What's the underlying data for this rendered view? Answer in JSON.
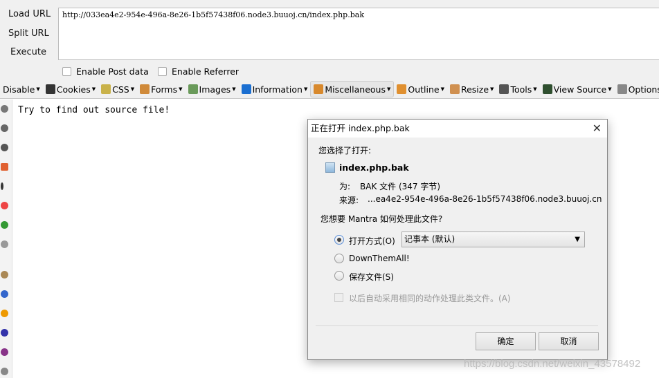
{
  "hackbar": {
    "load_url": "Load URL",
    "split_url": "Split URL",
    "execute": "Execute",
    "url": "http://033ea4e2-954e-496a-8e26-1b5f57438f06.node3.buuoj.cn/index.php.bak",
    "enable_post": "Enable Post data",
    "enable_referrer": "Enable Referrer"
  },
  "toolbar": [
    {
      "label": "Disable",
      "icon": "disable-icon",
      "color": "#d33"
    },
    {
      "label": "Cookies",
      "icon": "cookies-icon",
      "color": "#333"
    },
    {
      "label": "CSS",
      "icon": "css-icon",
      "color": "#c9b24a"
    },
    {
      "label": "Forms",
      "icon": "forms-icon",
      "color": "#d08a3a"
    },
    {
      "label": "Images",
      "icon": "images-icon",
      "color": "#6a9a5a"
    },
    {
      "label": "Information",
      "icon": "information-icon",
      "color": "#1b6fd1"
    },
    {
      "label": "Miscellaneous",
      "icon": "miscellaneous-icon",
      "color": "#d8892d"
    },
    {
      "label": "Outline",
      "icon": "outline-icon",
      "color": "#e09030"
    },
    {
      "label": "Resize",
      "icon": "resize-icon",
      "color": "#d09050"
    },
    {
      "label": "Tools",
      "icon": "tools-icon",
      "color": "#555"
    },
    {
      "label": "View Source",
      "icon": "view-source-icon",
      "color": "#2f4f2f"
    },
    {
      "label": "Options",
      "icon": "options-icon",
      "color": "#888"
    }
  ],
  "page": {
    "text": "Try to find out source file!"
  },
  "dialog": {
    "title": "正在打开 index.php.bak",
    "chosen": "您选择了打开:",
    "filename": "index.php.bak",
    "type_label": "为:",
    "type_value": "BAK 文件 (347 字节)",
    "source_label": "来源:",
    "source_value": "...ea4e2-954e-496a-8e26-1b5f57438f06.node3.buuoj.cn",
    "question": "您想要 Mantra 如何处理此文件?",
    "open_with": "打开方式(O)",
    "open_with_app": "记事本 (默认)",
    "downthemall": "DownThemAll!",
    "save_file": "保存文件(S)",
    "auto_checkbox": "以后自动采用相同的动作处理此类文件。(A)",
    "ok": "确定",
    "cancel": "取消"
  },
  "watermark": "https://blog.csdn.net/weixin_43578492"
}
